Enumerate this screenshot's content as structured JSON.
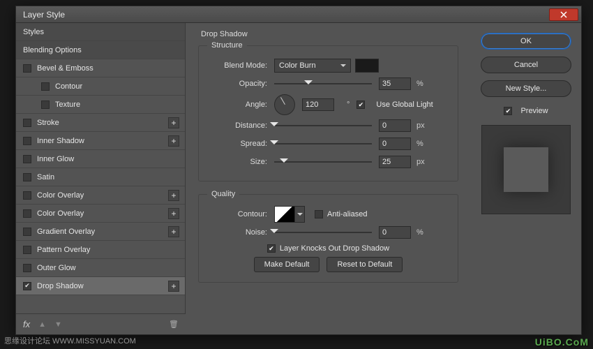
{
  "dialog": {
    "title": "Layer Style"
  },
  "styles": {
    "header": "Styles",
    "blending": "Blending Options",
    "bevel": "Bevel & Emboss",
    "contour": "Contour",
    "texture": "Texture",
    "stroke": "Stroke",
    "innerShadow": "Inner Shadow",
    "innerGlow": "Inner Glow",
    "satin": "Satin",
    "colorOverlay1": "Color Overlay",
    "colorOverlay2": "Color Overlay",
    "gradientOverlay": "Gradient Overlay",
    "patternOverlay": "Pattern Overlay",
    "outerGlow": "Outer Glow",
    "dropShadow": "Drop Shadow",
    "fx": "fx"
  },
  "panel": {
    "title": "Drop Shadow",
    "structure": "Structure",
    "blendModeLabel": "Blend Mode:",
    "blendModeValue": "Color Burn",
    "opacityLabel": "Opacity:",
    "opacityValue": "35",
    "opacityUnit": "%",
    "angleLabel": "Angle:",
    "angleValue": "120",
    "angleUnit": "°",
    "useGlobal": "Use Global Light",
    "distanceLabel": "Distance:",
    "distanceValue": "0",
    "distanceUnit": "px",
    "spreadLabel": "Spread:",
    "spreadValue": "0",
    "spreadUnit": "%",
    "sizeLabel": "Size:",
    "sizeValue": "25",
    "sizeUnit": "px",
    "quality": "Quality",
    "contourLabel": "Contour:",
    "antiAliased": "Anti-aliased",
    "noiseLabel": "Noise:",
    "noiseValue": "0",
    "noiseUnit": "%",
    "knocksOut": "Layer Knocks Out Drop Shadow",
    "makeDefault": "Make Default",
    "resetDefault": "Reset to Default"
  },
  "right": {
    "ok": "OK",
    "cancel": "Cancel",
    "newStyle": "New Style...",
    "preview": "Preview"
  },
  "watermark": "UiBO.CoM",
  "watermark2": "思缘设计论坛  WWW.MISSYUAN.COM"
}
